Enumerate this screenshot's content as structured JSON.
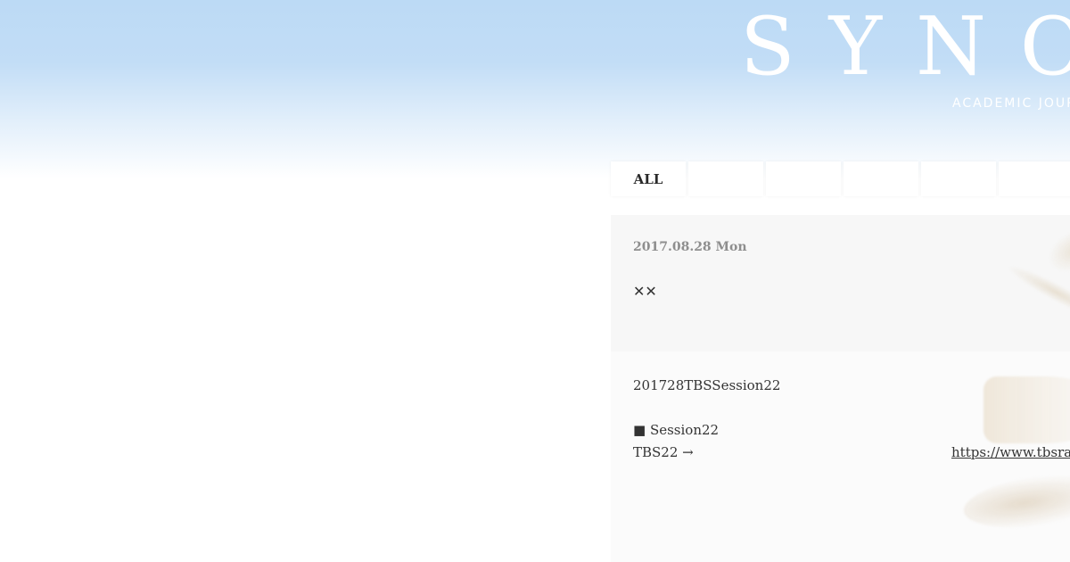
{
  "header": {
    "logo_text": "SYNO",
    "tagline": "ACADEMIC JOUR"
  },
  "tabs": [
    {
      "label": "ALL",
      "active": true
    },
    {
      "label": ""
    },
    {
      "label": ""
    },
    {
      "label": ""
    },
    {
      "label": ""
    },
    {
      "label": ""
    }
  ],
  "post": {
    "date": "2017.08.28 Mon",
    "title": "✕✕",
    "body": {
      "line1": "201728TBSSession22",
      "line2": "■ Session22",
      "line3": "TBS22 →",
      "link_text": "https://www.tbsrad"
    }
  },
  "colors": {
    "sky_top": "#bcdaf5",
    "post_head_bg": "#f7f7f7",
    "post_body_bg": "#fbfbfb",
    "date_text": "#8e8e8e",
    "text": "#333333"
  }
}
